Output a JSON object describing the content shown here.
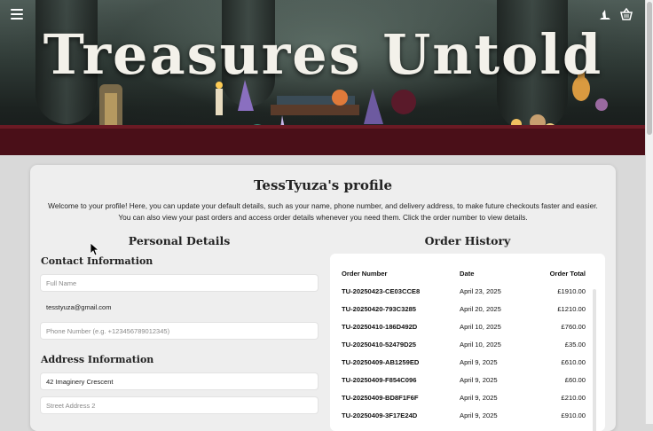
{
  "header": {
    "title": "Treasures Untold",
    "icons": [
      "menu-icon",
      "witch-hat-icon",
      "basket-icon"
    ]
  },
  "profile": {
    "title": "TessTyuza's profile",
    "welcome": "Welcome to your profile! Here, you can update your default details, such as your name, phone number, and delivery address, to make future checkouts faster and easier. You can also view your past orders and access order details whenever you need them. Click the order number to view details."
  },
  "personal": {
    "heading": "Personal Details",
    "contact_heading": "Contact Information",
    "full_name_placeholder": "Full Name",
    "email": "tesstyuza@gmail.com",
    "phone_placeholder": "Phone Number (e.g. +123456789012345)",
    "address_heading": "Address Information",
    "address1": "42 Imaginery Crescent",
    "address2_placeholder": "Street Address 2"
  },
  "orders": {
    "heading": "Order History",
    "columns": [
      "Order Number",
      "Date",
      "Order Total"
    ],
    "rows": [
      {
        "number": "TU-20250423-CE03CCE8",
        "date": "April 23, 2025",
        "total": "£1910.00"
      },
      {
        "number": "TU-20250420-793C3285",
        "date": "April 20, 2025",
        "total": "£1210.00"
      },
      {
        "number": "TU-20250410-186D492D",
        "date": "April 10, 2025",
        "total": "£760.00"
      },
      {
        "number": "TU-20250410-52479D25",
        "date": "April 10, 2025",
        "total": "£35.00"
      },
      {
        "number": "TU-20250409-AB1259ED",
        "date": "April 9, 2025",
        "total": "£610.00"
      },
      {
        "number": "TU-20250409-F854C096",
        "date": "April 9, 2025",
        "total": "£60.00"
      },
      {
        "number": "TU-20250409-BD8F1F6F",
        "date": "April 9, 2025",
        "total": "£210.00"
      },
      {
        "number": "TU-20250409-3F17E24D",
        "date": "April 9, 2025",
        "total": "£910.00"
      }
    ]
  },
  "colors": {
    "banner_shelf": "#5a1620",
    "card_bg": "#eeeeee",
    "page_bg": "#d9d9d9"
  }
}
